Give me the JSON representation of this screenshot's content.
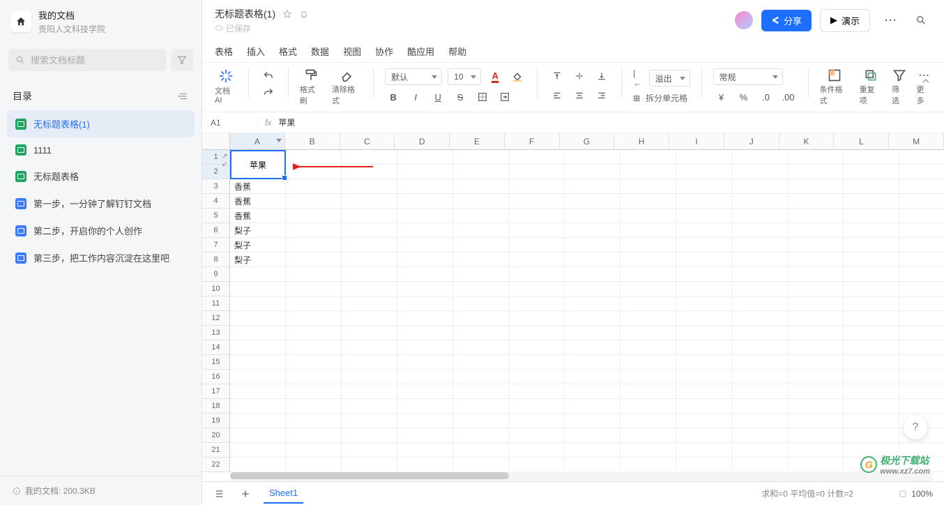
{
  "sidebar": {
    "title": "我的文档",
    "subtitle": "贵阳人文科技学院",
    "search_placeholder": "搜索文档标题",
    "directory_label": "目录",
    "items": [
      {
        "label": "无标题表格(1)",
        "type": "sheet",
        "active": true
      },
      {
        "label": "1111",
        "type": "sheet",
        "active": false
      },
      {
        "label": "无标题表格",
        "type": "sheet",
        "active": false
      },
      {
        "label": "第一步，一分钟了解钉钉文档",
        "type": "doc",
        "active": false
      },
      {
        "label": "第二步，开启你的个人创作",
        "type": "doc",
        "active": false
      },
      {
        "label": "第三步，把工作内容沉淀在这里吧",
        "type": "doc",
        "active": false
      }
    ],
    "footer": "我的文档: 200.3KB"
  },
  "header": {
    "doc_title": "无标题表格(1)",
    "saved_label": "已保存",
    "share_label": "分享",
    "demo_label": "演示"
  },
  "menus": [
    "表格",
    "插入",
    "格式",
    "数据",
    "视图",
    "协作",
    "酷应用",
    "帮助"
  ],
  "toolbar": {
    "docai": "文档AI",
    "format_painter": "格式刷",
    "clear_format": "清除格式",
    "font_default": "默认",
    "font_size": "10",
    "overflow": "溢出",
    "split_cell": "拆分单元格",
    "number_format": "常规",
    "cond_format": "条件格式",
    "duplicates": "重复项",
    "filter": "筛选",
    "more": "更多"
  },
  "cell_ref": "A1",
  "formula_value": "苹果",
  "columns": [
    "A",
    "B",
    "C",
    "D",
    "E",
    "F",
    "G",
    "H",
    "I",
    "J",
    "K",
    "L",
    "M"
  ],
  "row_count": 22,
  "active_col": 0,
  "merged_cell": {
    "row": 0,
    "col": 0,
    "rowspan": 2,
    "value": "苹果"
  },
  "cells": [
    {
      "r": 2,
      "c": 0,
      "v": "香蕉"
    },
    {
      "r": 3,
      "c": 0,
      "v": "香蕉"
    },
    {
      "r": 4,
      "c": 0,
      "v": "香蕉"
    },
    {
      "r": 5,
      "c": 0,
      "v": "梨子"
    },
    {
      "r": 6,
      "c": 0,
      "v": "梨子"
    },
    {
      "r": 7,
      "c": 0,
      "v": "梨子"
    }
  ],
  "sheet_tabs": {
    "current": "Sheet1"
  },
  "status": {
    "summary": "求和=0 平均值=0 计数=2",
    "zoom": "100%"
  },
  "watermark": {
    "brand": "极光下载站",
    "url": "www.xz7.com"
  },
  "colors": {
    "accent": "#1e6fff",
    "sheet_green": "#1fa561",
    "arrow": "#d22"
  }
}
